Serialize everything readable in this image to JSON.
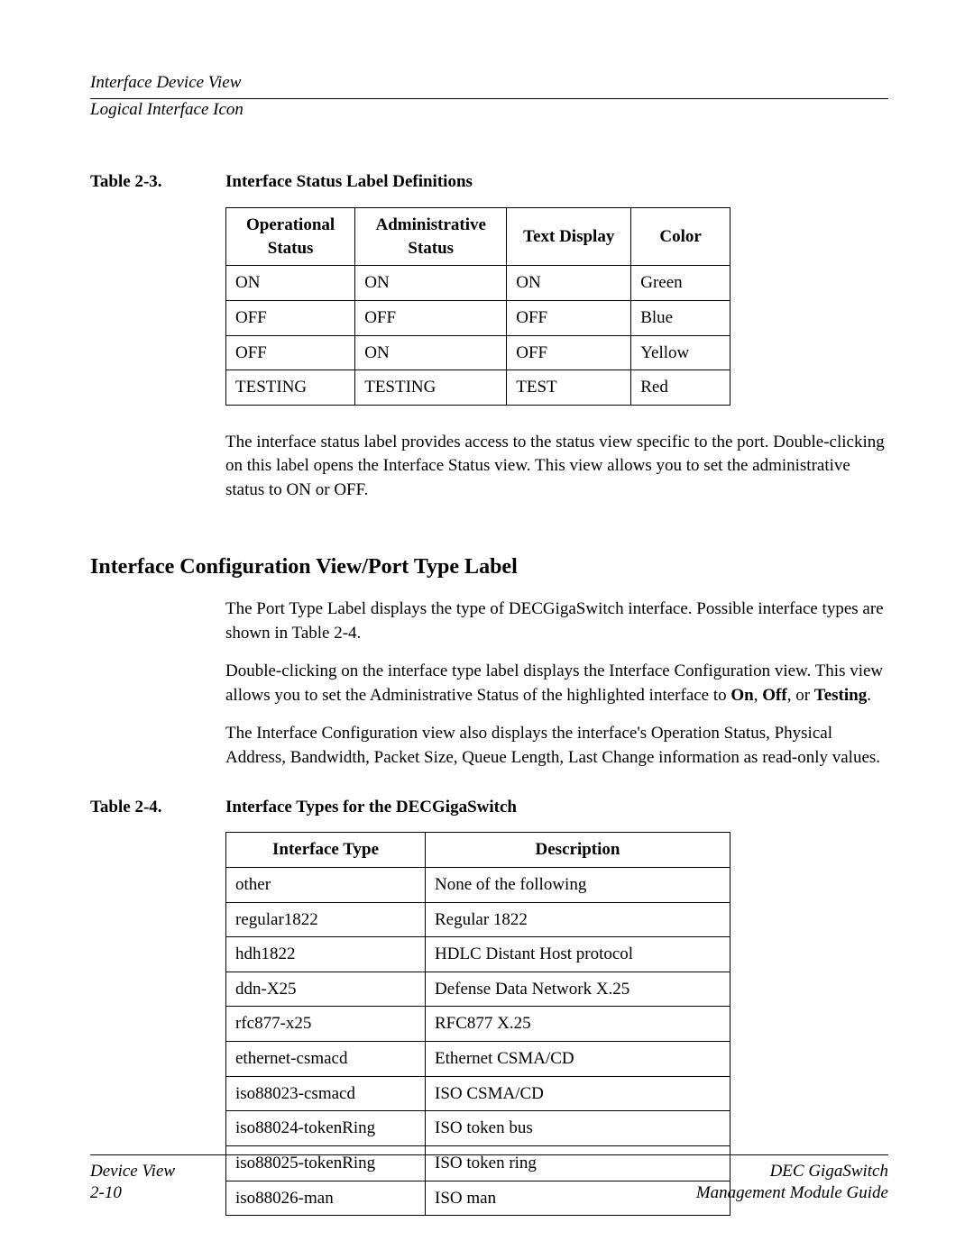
{
  "header": {
    "line1": "Interface Device View",
    "line2": "Logical Interface Icon"
  },
  "table1": {
    "label": "Table 2-3.",
    "title": "Interface Status Label Definitions",
    "headers": [
      "Operational Status",
      "Administrative Status",
      "Text Display",
      "Color"
    ],
    "rows": [
      [
        "ON",
        "ON",
        "ON",
        "Green"
      ],
      [
        "OFF",
        "OFF",
        "OFF",
        "Blue"
      ],
      [
        "OFF",
        "ON",
        "OFF",
        "Yellow"
      ],
      [
        "TESTING",
        "TESTING",
        "TEST",
        "Red"
      ]
    ]
  },
  "para1": "The interface status label provides access to the status view specific to the port. Double-clicking on this label opens the Interface Status view. This view allows you to set the administrative status to ON or OFF.",
  "section_heading": "Interface Configuration View/Port Type Label",
  "para2": "The Port Type Label displays the type of DECGigaSwitch interface. Possible interface types are shown in Table 2-4.",
  "para3_pre": "Double-clicking on the interface type label displays the Interface Configuration view. This view allows you to set the Administrative Status of the highlighted interface to ",
  "para3_bold1": "On",
  "para3_mid1": ", ",
  "para3_bold2": "Off",
  "para3_mid2": ", or ",
  "para3_bold3": "Testing",
  "para3_end": ".",
  "para4": "The Interface Configuration view also displays the interface's Operation Status, Physical Address, Bandwidth, Packet Size, Queue Length, Last Change information as read-only values.",
  "table2": {
    "label": "Table 2-4.",
    "title": "Interface Types for the DECGigaSwitch",
    "headers": [
      "Interface Type",
      "Description"
    ],
    "rows": [
      [
        "other",
        "None of the following"
      ],
      [
        "regular1822",
        "Regular 1822"
      ],
      [
        "hdh1822",
        "HDLC Distant Host protocol"
      ],
      [
        "ddn-X25",
        "Defense Data Network X.25"
      ],
      [
        "rfc877-x25",
        "RFC877 X.25"
      ],
      [
        "ethernet-csmacd",
        "Ethernet CSMA/CD"
      ],
      [
        "iso88023-csmacd",
        "ISO CSMA/CD"
      ],
      [
        "iso88024-tokenRing",
        "ISO token bus"
      ],
      [
        "iso88025-tokenRing",
        "ISO token ring"
      ],
      [
        "iso88026-man",
        "ISO man"
      ]
    ]
  },
  "footer": {
    "left1": "Device View",
    "left2": "2-10",
    "right1": "DEC GigaSwitch",
    "right2": "Management Module Guide"
  }
}
